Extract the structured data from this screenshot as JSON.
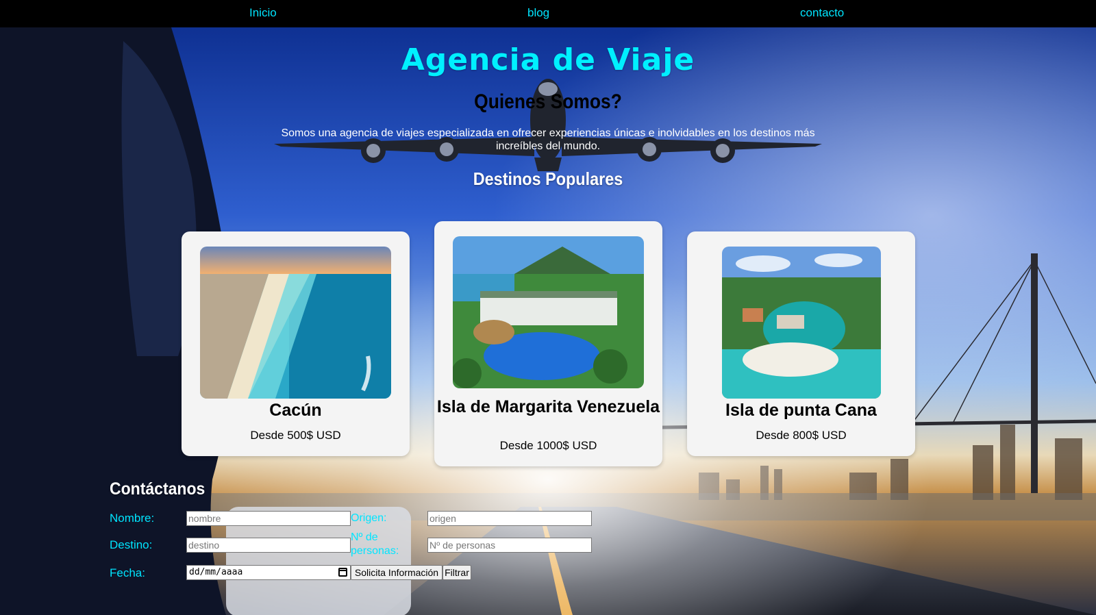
{
  "nav": {
    "items": [
      {
        "label": "Inicio"
      },
      {
        "label": "blog"
      },
      {
        "label": "contacto"
      }
    ]
  },
  "header": {
    "site_title": "Agencia de Viaje",
    "about_title": "Quienes Somos?",
    "about_text": "Somos una agencia de viajes especializada en ofrecer experiencias únicas e inolvidables en los destinos más increíbles del mundo.",
    "destinations_title": "Destinos Populares"
  },
  "destinations": [
    {
      "name": "Cacún",
      "price": "Desde 500$ USD"
    },
    {
      "name": "Isla de Margarita Venezuela",
      "price": "Desde 1000$ USD"
    },
    {
      "name": "Isla de punta Cana",
      "price": "Desde 800$ USD"
    }
  ],
  "contact": {
    "title": "Contáctanos",
    "nombre_label": "Nombre:",
    "nombre_placeholder": "nombre",
    "origen_label": "Origen:",
    "origen_placeholder": "origen",
    "destino_label": "Destino:",
    "destino_placeholder": "destino",
    "personas_label": "Nº de personas:",
    "personas_placeholder": "Nº de personas",
    "fecha_label": "Fecha:",
    "fecha_value": "dd/mm/aaaa",
    "submit_label": "Solicita Información",
    "filter_label": "Filtrar"
  },
  "colors": {
    "accent": "#00e5ff",
    "nav_bg": "#000000",
    "card_bg": "#f4f4f4"
  },
  "icons": [
    "calendar-icon"
  ]
}
